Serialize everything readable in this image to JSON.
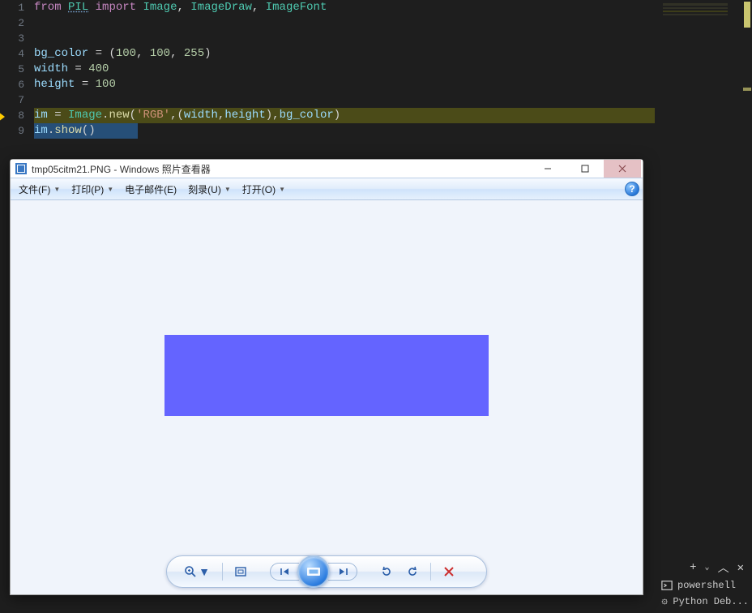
{
  "code": {
    "lines": [
      {
        "n": "1"
      },
      {
        "n": "2"
      },
      {
        "n": "3"
      },
      {
        "n": "4"
      },
      {
        "n": "5"
      },
      {
        "n": "6"
      },
      {
        "n": "7"
      },
      {
        "n": "8"
      },
      {
        "n": "9"
      }
    ],
    "line1": {
      "from": "from",
      "pil": "PIL",
      "import": "import",
      "image": "Image",
      "c1": ", ",
      "imagedraw": "ImageDraw",
      "c2": ", ",
      "imagefont": "ImageFont"
    },
    "line4": {
      "var": "bg_color",
      "eq": " = ",
      "lp": "(",
      "n1": "100",
      "c1": ", ",
      "n2": "100",
      "c2": ", ",
      "n3": "255",
      "rp": ")"
    },
    "line5": {
      "var": "width",
      "eq": " = ",
      "n": "400"
    },
    "line6": {
      "var": "height",
      "eq": " = ",
      "n": "100"
    },
    "line8": {
      "var": "im",
      "eq": " = ",
      "cls": "Image",
      "dot": ".",
      "fn": "new",
      "lp": "(",
      "str": "'RGB'",
      "c1": ",(",
      "w": "width",
      "c2": ",",
      "h": "height",
      "c3": "),",
      "bg": "bg_color",
      "rp": ")"
    },
    "line9": {
      "var": "im",
      "dot": ".",
      "fn": "show",
      "paren": "()"
    }
  },
  "viewer": {
    "title": "tmp05citm21.PNG - Windows 照片查看器",
    "menu": {
      "file": "文件(F)",
      "print": "打印(P)",
      "email": "电子邮件(E)",
      "burn": "刻录(U)",
      "open": "打开(O)"
    },
    "help_tooltip": "?"
  },
  "terminal": {
    "row1": "powershell",
    "row2": "Python Deb..."
  }
}
